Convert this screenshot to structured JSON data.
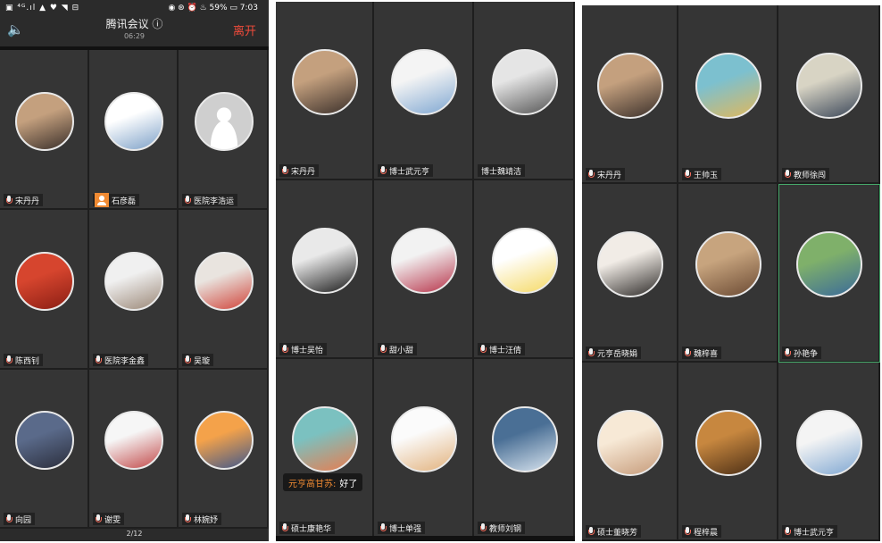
{
  "screens": [
    {
      "statusbar": {
        "left": "▣ ⁴ᴳ.ıl ▲ ♥ ◥ ⊟",
        "right": "◉ ⊛ ⏰ ♨ 59% ▭ 7:03"
      },
      "header": {
        "speaker_icon": "speaker-icon",
        "title": "腾讯会议 ⓘ",
        "timer": "06:29",
        "leave": "离开"
      },
      "page_indicator": "2/12",
      "tiles": [
        {
          "name": "宋丹丹",
          "icon": "mic-icon",
          "avatar_colors": [
            "#c4a07e",
            "#3a2f2a"
          ]
        },
        {
          "name": "石彦磊",
          "icon": "user-icon",
          "avatar_colors": [
            "#ffffff",
            "#7ea1c8"
          ]
        },
        {
          "name": "医院李浩运",
          "icon": "mic-icon",
          "avatar_colors": [
            "#cfcfcf",
            "#a9a9a9"
          ],
          "default_avatar": true
        },
        {
          "name": "陈西钊",
          "icon": "mic-icon",
          "avatar_colors": [
            "#d6452e",
            "#8a1e14"
          ]
        },
        {
          "name": "医院李金鑫",
          "icon": "mic-icon",
          "avatar_colors": [
            "#f0f0f0",
            "#9b8878"
          ]
        },
        {
          "name": "吴璇",
          "icon": "mic-icon",
          "avatar_colors": [
            "#e9e4df",
            "#d0443a"
          ]
        },
        {
          "name": "向园",
          "icon": "mic-icon",
          "avatar_colors": [
            "#5a6a8a",
            "#2b2e3c"
          ]
        },
        {
          "name": "谢雯",
          "icon": "mic-icon",
          "avatar_colors": [
            "#f6f6f6",
            "#c24a4a"
          ]
        },
        {
          "name": "林婉妤",
          "icon": "mic-icon",
          "avatar_colors": [
            "#f4a24a",
            "#41588a"
          ]
        }
      ]
    },
    {
      "chat": {
        "sender": "元亨高甘苏:",
        "text": "好了"
      },
      "tiles": [
        {
          "name": "宋丹丹",
          "icon": "mic-icon",
          "avatar_colors": [
            "#c4a07e",
            "#3a2f2a"
          ]
        },
        {
          "name": "博士武元亨",
          "icon": "mic-icon",
          "avatar_colors": [
            "#f4f4f4",
            "#7fa7d2"
          ]
        },
        {
          "name": "博士魏靖洁",
          "icon": "none",
          "avatar_colors": [
            "#e5e5e5",
            "#555555"
          ]
        },
        {
          "name": "博士吴怡",
          "icon": "mic-icon",
          "avatar_colors": [
            "#e9e9e9",
            "#1b1b1b"
          ]
        },
        {
          "name": "甜小甜",
          "icon": "mic-icon",
          "avatar_colors": [
            "#f2f2f2",
            "#b7344a"
          ]
        },
        {
          "name": "博士汪倩",
          "icon": "mic-icon",
          "avatar_colors": [
            "#ffffff",
            "#f5d964"
          ]
        },
        {
          "name": "硕士康艳华",
          "icon": "mic-icon",
          "avatar_colors": [
            "#7bc1c0",
            "#e97c4e"
          ]
        },
        {
          "name": "博士单强",
          "icon": "mic-icon",
          "avatar_colors": [
            "#fbfbfb",
            "#e2b27d"
          ]
        },
        {
          "name": "教师刘钢",
          "icon": "mic-icon",
          "avatar_colors": [
            "#4a6f95",
            "#d8e4ef"
          ]
        }
      ]
    },
    {
      "tiles": [
        {
          "name": "宋丹丹",
          "icon": "mic-icon",
          "avatar_colors": [
            "#c4a07e",
            "#3a2f2a"
          ]
        },
        {
          "name": "王帅玉",
          "icon": "mic-icon",
          "avatar_colors": [
            "#7cc0cf",
            "#e0b85c"
          ]
        },
        {
          "name": "教师徐闯",
          "icon": "mic-icon",
          "avatar_colors": [
            "#d8d4c4",
            "#3a4658"
          ]
        },
        {
          "name": "元亨岳晓娟",
          "icon": "mic-icon",
          "avatar_colors": [
            "#f1ece6",
            "#2e2b29"
          ]
        },
        {
          "name": "魏梓喜",
          "icon": "mic-icon",
          "avatar_colors": [
            "#c7a47e",
            "#6b4a33"
          ]
        },
        {
          "name": "孙艳争",
          "icon": "mic-icon",
          "avatar_colors": [
            "#7fb06a",
            "#3a6a9a"
          ],
          "active": true
        },
        {
          "name": "硕士董晓芳",
          "icon": "mic-icon",
          "avatar_colors": [
            "#f7e9d6",
            "#c69b7a"
          ]
        },
        {
          "name": "程梓晨",
          "icon": "mic-icon",
          "avatar_colors": [
            "#c7873f",
            "#4b2e15"
          ]
        },
        {
          "name": "博士武元亨",
          "icon": "mic-icon",
          "avatar_colors": [
            "#f4f4f4",
            "#7fa7d2"
          ]
        }
      ]
    }
  ]
}
